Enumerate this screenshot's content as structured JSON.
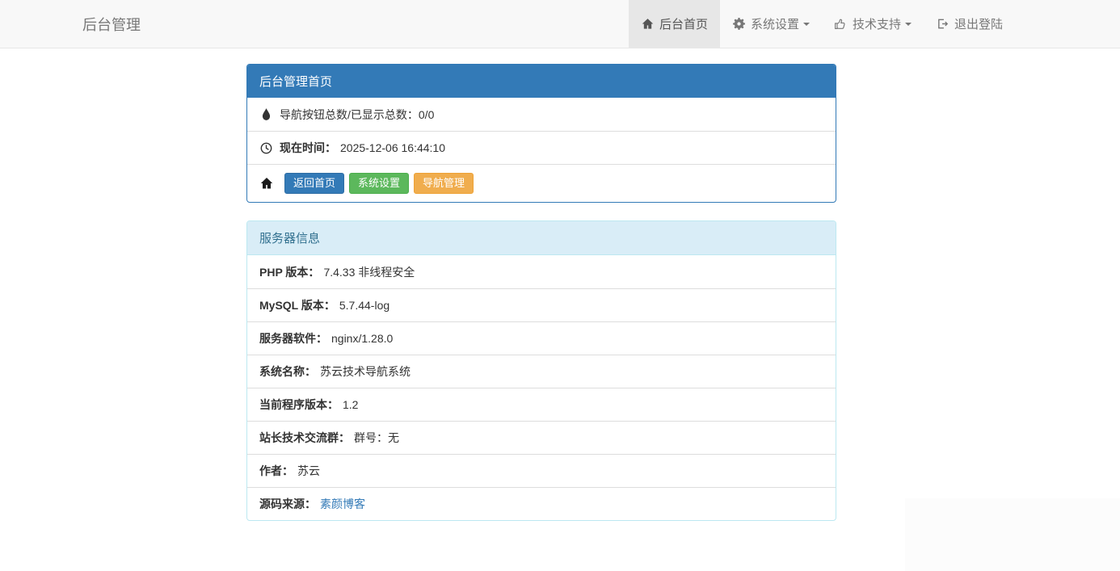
{
  "navbar": {
    "brand": "后台管理",
    "items": [
      {
        "label": "后台首页",
        "icon": "home-icon",
        "active": true,
        "caret": false
      },
      {
        "label": "系统设置",
        "icon": "gear-icon",
        "active": false,
        "caret": true
      },
      {
        "label": "技术支持",
        "icon": "thumbs-up-icon",
        "active": false,
        "caret": true
      },
      {
        "label": "退出登陆",
        "icon": "sign-out-icon",
        "active": false,
        "caret": false
      }
    ]
  },
  "dashboard_panel": {
    "title": "后台管理首页",
    "rows": [
      {
        "icon": "tint-icon",
        "text": "导航按钮总数/已显示总数：0/0"
      },
      {
        "icon": "clock-icon",
        "label": "现在时间：",
        "value": "2025-12-06 16:44:10"
      }
    ],
    "buttons": [
      {
        "label": "返回首页",
        "color": "#337ab7"
      },
      {
        "label": "系统设置",
        "color": "#5cb85c"
      },
      {
        "label": "导航管理",
        "color": "#f0ad4e"
      }
    ]
  },
  "server_panel": {
    "title": "服务器信息",
    "rows": [
      {
        "label": "PHP 版本：",
        "value": "7.4.33 非线程安全"
      },
      {
        "label": "MySQL 版本：",
        "value": "5.7.44-log"
      },
      {
        "label": "服务器软件：",
        "value": "nginx/1.28.0"
      },
      {
        "label": "系统名称：",
        "value": "苏云技术导航系统"
      },
      {
        "label": "当前程序版本：",
        "value": "1.2"
      },
      {
        "label": "站长技术交流群：",
        "value": "群号：无"
      },
      {
        "label": "作者：",
        "value": "苏云"
      },
      {
        "label": "源码来源：",
        "value": "素颜博客",
        "link": true
      }
    ]
  },
  "colors": {
    "navbar_bg": "#f8f8f8",
    "navbar_border": "#e7e7e7",
    "navbar_active_bg": "#e7e7e7",
    "panel_primary": "#337ab7",
    "panel_info_bg": "#d9edf7",
    "panel_info_text": "#31708f",
    "panel_info_border": "#bce8f1",
    "btn_primary": "#337ab7",
    "btn_success": "#5cb85c",
    "btn_warning": "#f0ad4e",
    "link": "#337ab7",
    "row_divider": "#dddddd"
  }
}
